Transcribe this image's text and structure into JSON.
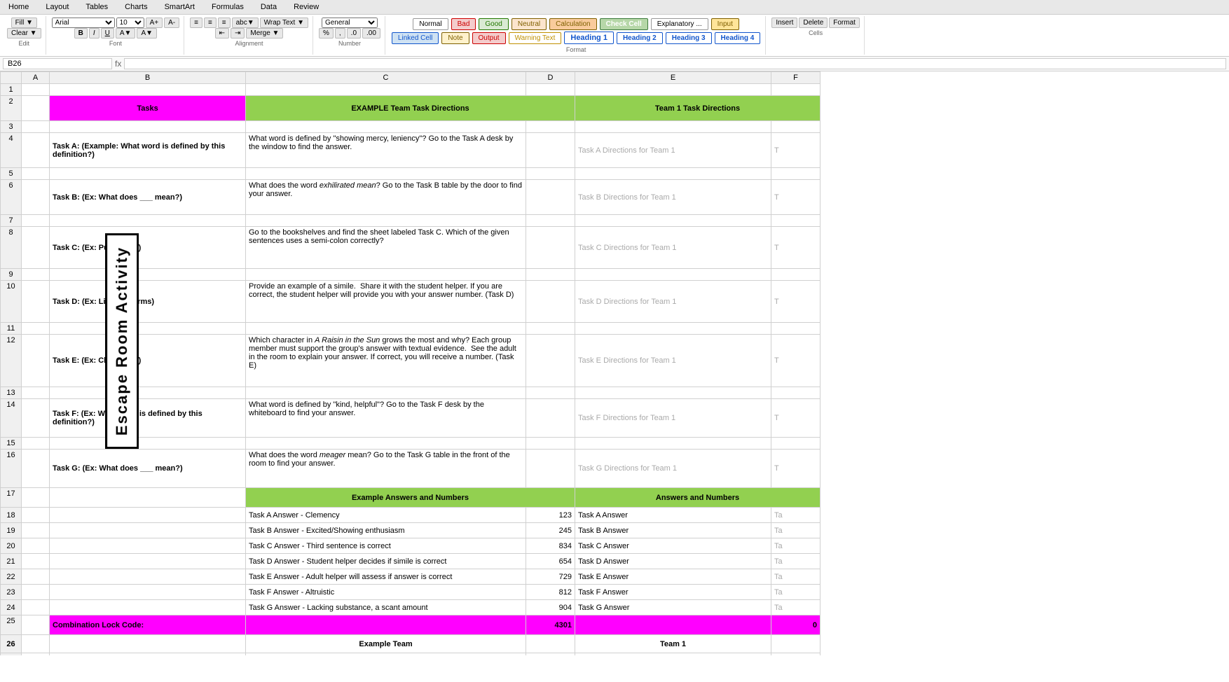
{
  "app": {
    "menu_items": [
      "Home",
      "Layout",
      "Tables",
      "Charts",
      "SmartArt",
      "Formulas",
      "Data",
      "Review"
    ]
  },
  "toolbar": {
    "groups": [
      {
        "label": "Edit",
        "buttons": [
          "Fill ▼",
          "Clear ▼"
        ]
      },
      {
        "label": "Font",
        "buttons": [
          "Arial",
          "10",
          "A+",
          "A-",
          "B",
          "I",
          "U"
        ]
      },
      {
        "label": "Alignment",
        "buttons": [
          "≡",
          "≡",
          "≡",
          "abc ▼",
          "Wrap Text ▼",
          "Merge ▼"
        ]
      },
      {
        "label": "Number",
        "buttons": [
          "General ▼",
          "%",
          ",",
          ".0",
          ".00"
        ]
      },
      {
        "label": "Format",
        "styles": [
          {
            "label": "Normal",
            "cls": "style-normal"
          },
          {
            "label": "Bad",
            "cls": "style-bad"
          },
          {
            "label": "Good",
            "cls": "style-good"
          },
          {
            "label": "Neutral",
            "cls": "style-neutral"
          },
          {
            "label": "Calculation",
            "cls": "style-calculation"
          },
          {
            "label": "Check Cell",
            "cls": "style-check-cell"
          },
          {
            "label": "Explanatory ...",
            "cls": "style-explanatory"
          },
          {
            "label": "Input",
            "cls": "style-input"
          },
          {
            "label": "Linked Cell",
            "cls": "style-linked-cell"
          },
          {
            "label": "Note",
            "cls": "style-note"
          },
          {
            "label": "Output",
            "cls": "style-output"
          },
          {
            "label": "Warning Text",
            "cls": "style-warning"
          },
          {
            "label": "Heading 1",
            "cls": "style-h1"
          },
          {
            "label": "Heading 2",
            "cls": "style-h2"
          },
          {
            "label": "Heading 3",
            "cls": "style-h3"
          },
          {
            "label": "Heading 4",
            "cls": "style-h4"
          }
        ]
      },
      {
        "label": "Cells",
        "buttons": [
          "Insert",
          "Delete",
          "Format"
        ]
      }
    ]
  },
  "formula_bar": {
    "cell_ref": "B26",
    "formula": ""
  },
  "sidebar_text": "Escape Room Activity",
  "columns": {
    "headers": [
      "",
      "A",
      "B",
      "C",
      "D",
      "E",
      "F"
    ],
    "widths": [
      30,
      40,
      260,
      380,
      80,
      280,
      80
    ]
  },
  "spreadsheet": {
    "header_row": {
      "col_b": "Tasks",
      "col_c": "EXAMPLE Team Task Directions",
      "col_e": "Team 1 Task Directions"
    },
    "tasks": [
      {
        "row_label": "Task A",
        "task_text": "Task A: (Example: What word is defined by this definition?)",
        "example_direction": "What word is defined by \"showing mercy, leniency\"? Go to the Task A desk by the window to find the answer.",
        "team1_direction": "Task A Directions for Team 1"
      },
      {
        "row_label": "Task B",
        "task_text": "Task B: (Ex: What does ___ mean?)",
        "example_direction": "What does the word exhilirated mean? Go to the Task B table by the door to find your answer.",
        "team1_direction": "Task B Directions for Team 1"
      },
      {
        "row_label": "Task C",
        "task_text": "Task C: (Ex: Puctuation)",
        "example_direction": "Go to the bookshelves and find the sheet labeled Task C. Which of the given sentences uses a semi-colon correctly?",
        "team1_direction": "Task C Directions for Team 1"
      },
      {
        "row_label": "Task D",
        "task_text": "Task D: (Ex: Literary Terms)",
        "example_direction": "Provide an example of a simile.  Share it with the student helper. If you are correct, the student helper will provide you with your answer number. (Task D)",
        "team1_direction": "Task D Directions for Team 1"
      },
      {
        "row_label": "Task E",
        "task_text": "Task E: (Ex: Characters)",
        "example_direction": "Which character in A Raisin in the Sun grows the most and why? Each group member must support the group's answer with textual evidence.  See the adult in the room to explain your answer. If correct, you will receive a number. (Task E)",
        "team1_direction": "Task E Directions for Team 1"
      },
      {
        "row_label": "Task F",
        "task_text": "Task F: (Ex: What word is defined by this definition?)",
        "example_direction": "What word is defined by \"kind, helpful\"? Go to the Task F desk by the whiteboard to find your answer.",
        "team1_direction": "Task F Directions for Team 1"
      },
      {
        "row_label": "Task G",
        "task_text": "Task G: (Ex: What does ___ mean?)",
        "example_direction": "What does the word meager mean? Go to the Task G table in the front of the room to find your answer.",
        "team1_direction": "Task G Directions for Team 1"
      }
    ],
    "answers_header": {
      "example": "Example Answers and Numbers",
      "team1": "Answers and Numbers"
    },
    "answers": [
      {
        "example_text": "Task A Answer - Clemency",
        "example_num": "123",
        "team1_text": "Task A Answer",
        "team1_col": "Ta"
      },
      {
        "example_text": "Task B Answer - Excited/Showing enthusiasm",
        "example_num": "245",
        "team1_text": "Task B Answer",
        "team1_col": "Ta"
      },
      {
        "example_text": "Task C Answer - Third sentence is correct",
        "example_num": "834",
        "team1_text": "Task C Answer",
        "team1_col": "Ta"
      },
      {
        "example_text": "Task D Answer - Student helper decides if simile is correct",
        "example_num": "654",
        "team1_text": "Task D Answer",
        "team1_col": "Ta"
      },
      {
        "example_text": "Task E Answer - Adult helper will assess if answer is correct",
        "example_num": "729",
        "team1_text": "Task E Answer",
        "team1_col": "Ta"
      },
      {
        "example_text": "Task F Answer - Altruistic",
        "example_num": "812",
        "team1_text": "Task F Answer",
        "team1_col": "Ta"
      },
      {
        "example_text": "Task G Answer - Lacking substance, a scant amount",
        "example_num": "904",
        "team1_text": "Task G Answer",
        "team1_col": "Ta"
      }
    ],
    "combo_row": {
      "label": "Combination Lock Code:",
      "example_num": "4301",
      "team1_num": "0"
    },
    "team_names_row": {
      "example": "Example Team",
      "team1": "Team 1"
    }
  }
}
